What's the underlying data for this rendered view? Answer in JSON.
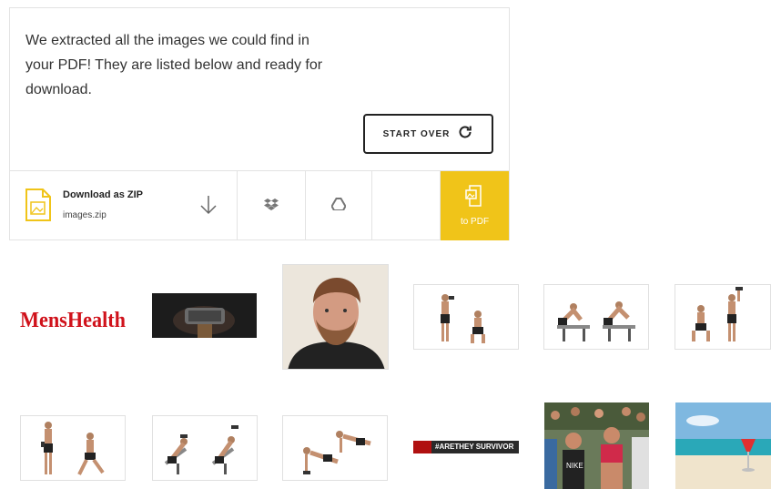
{
  "panel": {
    "message": "We extracted all the images we could find in your PDF! They are listed below and ready for download.",
    "start_over_label": "START OVER"
  },
  "download": {
    "title": "Download as ZIP",
    "filename": "images.zip",
    "icons": [
      "zip-file-icon",
      "download-arrow-icon",
      "dropbox-icon",
      "google-drive-icon"
    ]
  },
  "to_pdf": {
    "label": "to PDF",
    "color": "#f0c419"
  },
  "images": {
    "logo_text": "MensHealth",
    "banner_text": "#ARETHEY SURVIVOR"
  }
}
